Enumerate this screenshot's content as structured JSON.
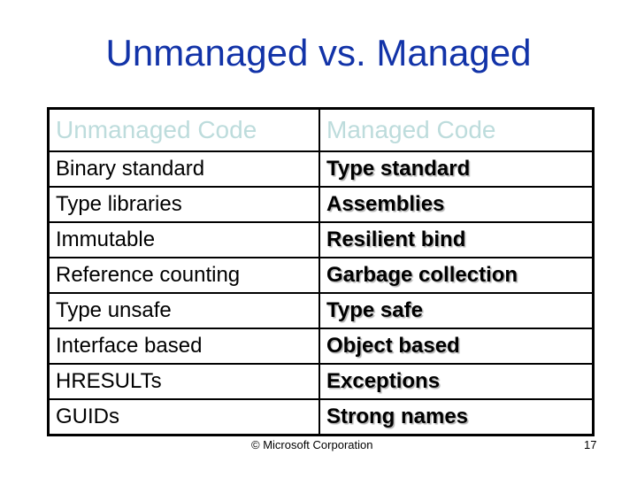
{
  "slide": {
    "title": "Unmanaged vs. Managed",
    "colors": {
      "title": "#1233a8",
      "table_header": "#bddcdc",
      "body_text": "#000000"
    }
  },
  "table": {
    "headers": [
      "Unmanaged Code",
      "Managed Code"
    ],
    "rows": [
      [
        "Binary standard",
        "Type standard"
      ],
      [
        "Type libraries",
        "Assemblies"
      ],
      [
        "Immutable",
        "Resilient bind"
      ],
      [
        "Reference counting",
        "Garbage collection"
      ],
      [
        "Type unsafe",
        "Type safe"
      ],
      [
        "Interface based",
        "Object based"
      ],
      [
        "HRESULTs",
        "Exceptions"
      ],
      [
        "GUIDs",
        "Strong names"
      ]
    ]
  },
  "footer": {
    "copyright": "© Microsoft Corporation",
    "page_number": "17"
  }
}
